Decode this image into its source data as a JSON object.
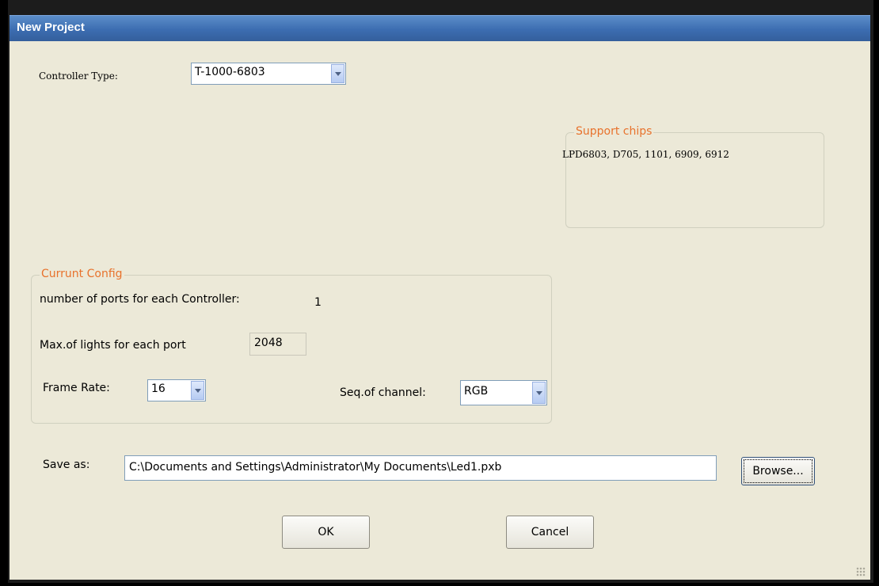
{
  "window": {
    "title": "New Project"
  },
  "controller": {
    "label": "Controller Type:",
    "value": "T-1000-6803"
  },
  "support_chips": {
    "legend": "Support chips",
    "text": "LPD6803, D705, 1101, 6909, 6912"
  },
  "config": {
    "legend": "Currunt Config",
    "ports_label": "number of ports for each Controller:",
    "ports_value": "1",
    "max_lights_label": "Max.of lights for each port",
    "max_lights_value": "2048",
    "frame_rate_label": "Frame Rate:",
    "frame_rate_value": "16",
    "seq_label": "Seq.of channel:",
    "seq_value": "RGB"
  },
  "save": {
    "label": "Save as:",
    "path": "C:\\Documents and Settings\\Administrator\\My Documents\\Led1.pxb",
    "browse_label": "Browse..."
  },
  "buttons": {
    "ok": "OK",
    "cancel": "Cancel"
  }
}
